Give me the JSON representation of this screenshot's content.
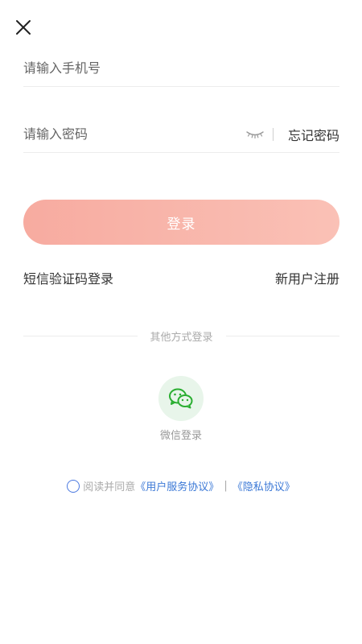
{
  "colors": {
    "accent_start": "#f7aba0",
    "accent_end": "#fac1b6",
    "link_blue": "#3b78d6",
    "wechat_green": "#2aae31"
  },
  "header": {
    "close_icon": "close-icon"
  },
  "form": {
    "phone_placeholder": "请输入手机号",
    "password_placeholder": "请输入密码",
    "eye_icon": "eye-closed-icon",
    "forgot_label": "忘记密码"
  },
  "login_button_label": "登录",
  "links": {
    "sms_login": "短信验证码登录",
    "register": "新用户注册"
  },
  "other_login": {
    "label": "其他方式登录",
    "wechat_icon": "wechat-icon",
    "wechat_label": "微信登录"
  },
  "agreement": {
    "prefix": "阅读并同意",
    "user_agreement": "《用户服务协议》",
    "separator": "|",
    "privacy_policy": "《隐私协议》"
  }
}
